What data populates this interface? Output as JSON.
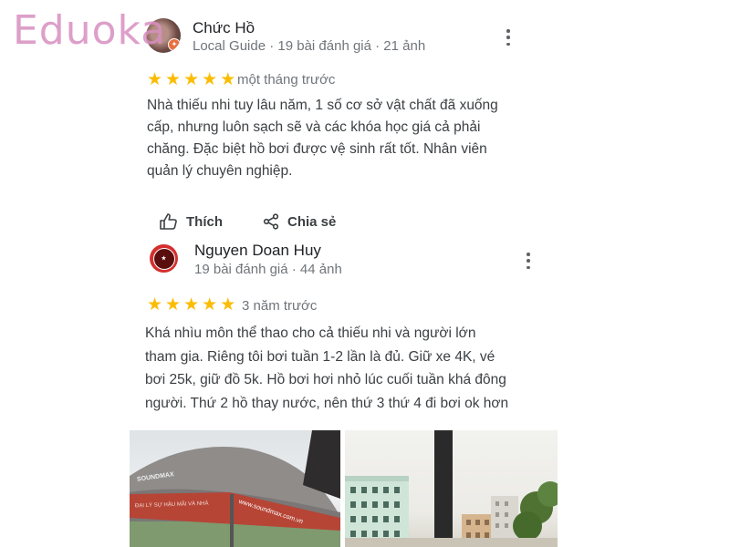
{
  "watermark": "Eduoka",
  "reviews": [
    {
      "author": "Chức Hồ",
      "meta": "Local Guide · 19 bài đánh giá · 21 ảnh",
      "rating": 5,
      "age": "một tháng trước",
      "text_lines": [
        "Nhà thiếu nhi tuy lâu năm, 1 số cơ sở vật chất đã xuống",
        "cấp, nhưng luôn sạch sẽ và các khóa học giá cả phải",
        "chăng. Đặc biệt hồ bơi được vệ sinh rất tốt. Nhân viên",
        "quản lý chuyên nghiệp."
      ],
      "actions": {
        "like": "Thích",
        "share": "Chia sẻ"
      }
    },
    {
      "author": "Nguyen Doan Huy",
      "meta": "19 bài đánh giá · 44 ảnh",
      "rating": 5,
      "age": "3 năm trước",
      "text_lines": [
        "Khá nhìu môn thể thao cho cả thiếu nhi và người lớn",
        "tham gia. Riêng tôi bơi tuần 1-2 lần là đủ. Giữ xe 4K, vé",
        "bơi 25k, giữ đồ 5k. Hồ bơi hơi nhỏ lúc cuối tuần khá đông",
        "người. Thứ 2 hồ thay nước, nên thứ 3 thứ 4 đi bơi ok hơn"
      ],
      "photos": [
        {
          "desc": "umbrella photo",
          "umbrella_text": "SOUNDMAX",
          "umbrella_text2": "ĐẠI LÝ SỰ HẬU MÃI VÀ NHÀ",
          "umbrella_url": "www.soundmax.com.vn"
        },
        {
          "desc": "buildings photo"
        }
      ]
    }
  ],
  "colors": {
    "star": "#fbbc04",
    "watermark": "#d88fc0",
    "badge": "#e9703f",
    "avatar2": "#d32f2f"
  },
  "icons": [
    "star-icon",
    "thumbs-up-icon",
    "share-icon",
    "more-vert-icon",
    "local-guide-badge-icon"
  ]
}
